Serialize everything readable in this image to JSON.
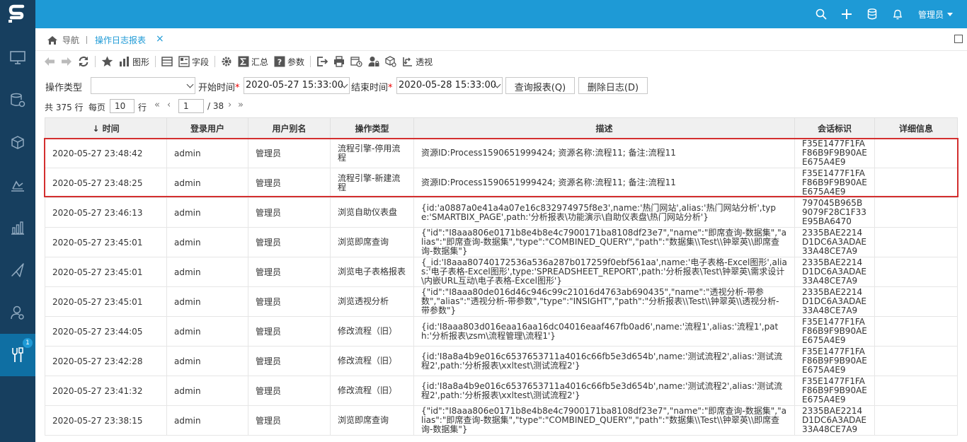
{
  "app": {
    "user_label": "管理员",
    "colors": {
      "topbar": "#1e9ad6",
      "sidebar": "#173f5f",
      "highlight": "#d32f2f"
    }
  },
  "top_icons": [
    "search-icon",
    "plus-icon",
    "database-icon",
    "bell-icon"
  ],
  "sidebar": {
    "items": [
      {
        "icon": "monitor-icon"
      },
      {
        "icon": "data-settings-icon"
      },
      {
        "icon": "cube-icon"
      },
      {
        "icon": "analysis-icon"
      },
      {
        "icon": "bar-chart-icon"
      },
      {
        "icon": "send-icon"
      },
      {
        "icon": "user-settings-icon"
      },
      {
        "icon": "tools-icon",
        "badge": "1",
        "active": true
      }
    ]
  },
  "tabs": {
    "home_label": "导航",
    "active_label": "操作日志报表",
    "close_glyph": "×"
  },
  "toolbar": {
    "chart_label": "图形",
    "field_label": "字段",
    "summary_label": "汇总",
    "param_label": "参数",
    "pivot_label": "透视"
  },
  "filters": {
    "op_type_label": "操作类型",
    "op_type_value": "",
    "start_label": "开始时间",
    "start_value": "2020-05-27 15:33:00",
    "end_label": "结束时间",
    "end_value": "2020-05-28 15:33:00",
    "required_mark": "*",
    "query_button": "查询报表(Q)",
    "delete_button": "删除日志(D)"
  },
  "pager": {
    "total_text": "共 375 行",
    "per_page_label": "每页",
    "per_page_value": "10",
    "rows_unit": "行",
    "current_page": "1",
    "total_pages_text": "/ 38",
    "first_glyph": "«",
    "prev_glyph": "‹",
    "next_glyph": "›",
    "last_glyph": "»"
  },
  "table": {
    "headers": [
      "↓ 时间",
      "登录用户",
      "用户别名",
      "操作类型",
      "描述",
      "会话标识",
      "详细信息"
    ],
    "rows": [
      {
        "time": "2020-05-27  23:48:42",
        "user": "admin",
        "alias": "管理员",
        "type": "流程引擎-停用流程",
        "desc": "资源ID:Process1590651999424; 资源名称:流程11; 备注:流程11",
        "session": "F35E1477F1FAF86B9F9B90AEE675A4E9",
        "detail": ""
      },
      {
        "time": "2020-05-27  23:48:25",
        "user": "admin",
        "alias": "管理员",
        "type": "流程引擎-新建流程",
        "desc": "资源ID:Process1590651999424; 资源名称:流程11; 备注:流程11",
        "session": "F35E1477F1FAF86B9F9B90AEE675A4E9",
        "detail": ""
      },
      {
        "time": "2020-05-27  23:46:13",
        "user": "admin",
        "alias": "管理员",
        "type": "浏览自助仪表盘",
        "desc": "{id:'a0887a0e41a4a07e16c832974975f8e3',name:'热门网站',alias:'热门网站分析',type:'SMARTBIX_PAGE',path:'分析报表\\功能演示\\自助仪表盘\\热门网站分析'}",
        "session": "797045B965B9079F28C1F33E95BA6470",
        "detail": ""
      },
      {
        "time": "2020-05-27  23:45:01",
        "user": "admin",
        "alias": "管理员",
        "type": "浏览即席查询",
        "desc": "{\"id\":\"I8aaa806e0171b8e4b8e4c7900171ba8108df23e7\",\"name\":\"即席查询-数据集\",\"alias\":\"即席查询-数据集\",\"type\":\"COMBINED_QUERY\",\"path\":\"数据集\\\\Test\\\\钟翠英\\\\即席查询-数据集\"}",
        "session": "2335BAE2214D1DC6A3ADAE33A48CE7A9",
        "detail": ""
      },
      {
        "time": "2020-05-27  23:45:01",
        "user": "admin",
        "alias": "管理员",
        "type": "浏览电子表格报表",
        "desc": "{_id:'I8aaa80740172536a536a287b017259f0ebf561aa',name:'电子表格-Excel图形',alias:'电子表格-Excel图形',type:'SPREADSHEET_REPORT',path:'分析报表\\Test\\钟翠英\\需求设计\\内嵌URL互动\\电子表格-Excel图形'}",
        "session": "2335BAE2214D1DC6A3ADAE33A48CE7A9",
        "detail": ""
      },
      {
        "time": "2020-05-27  23:45:01",
        "user": "admin",
        "alias": "管理员",
        "type": "浏览透视分析",
        "desc": "{\"id\":\"I8aaa80de016d46c946c99c21016d4763ab690435\",\"name\":\"透视分析-带参数\",\"alias\":\"透视分析-带参数\",\"type\":\"INSIGHT\",\"path\":\"分析报表\\\\Test\\\\钟翠英\\\\透视分析-带参数\"}",
        "session": "2335BAE2214D1DC6A3ADAE33A48CE7A9",
        "detail": ""
      },
      {
        "time": "2020-05-27  23:44:05",
        "user": "admin",
        "alias": "管理员",
        "type": "修改流程（旧）",
        "desc": "{id:'I8aaa803d016eaa16aa16dc04016eaaf467fb0ad6',name:'流程1',alias:'流程1',path:'分析报表\\zsm\\流程管理\\流程1'}",
        "session": "F35E1477F1FAF86B9F9B90AEE675A4E9",
        "detail": ""
      },
      {
        "time": "2020-05-27  23:42:28",
        "user": "admin",
        "alias": "管理员",
        "type": "修改流程（旧）",
        "desc": "{id:'I8a8a4b9e016c6537653711a4016c66fb5e3d654b',name:'测试流程2',alias:'测试流程2',path:'分析报表\\xxltest\\测试流程2'}",
        "session": "F35E1477F1FAF86B9F9B90AEE675A4E9",
        "detail": ""
      },
      {
        "time": "2020-05-27  23:41:32",
        "user": "admin",
        "alias": "管理员",
        "type": "修改流程（旧）",
        "desc": "{id:'I8a8a4b9e016c6537653711a4016c66fb5e3d654b',name:'测试流程2',alias:'测试流程2',path:'分析报表\\xxltest\\测试流程2'}",
        "session": "F35E1477F1FAF86B9F9B90AEE675A4E9",
        "detail": ""
      },
      {
        "time": "2020-05-27  23:38:15",
        "user": "admin",
        "alias": "管理员",
        "type": "浏览即席查询",
        "desc": "{\"id\":\"I8aaa806e0171b8e4b8e4c7900171ba8108df23e7\",\"name\":\"即席查询-数据集\",\"alias\":\"即席查询-数据集\",\"type\":\"COMBINED_QUERY\",\"path\":\"数据集\\\\Test\\\\钟翠英\\\\即席查询-数据集\"}",
        "session": "2335BAE2214D1DC6A3ADAE33A48CE7A9",
        "detail": ""
      }
    ]
  }
}
